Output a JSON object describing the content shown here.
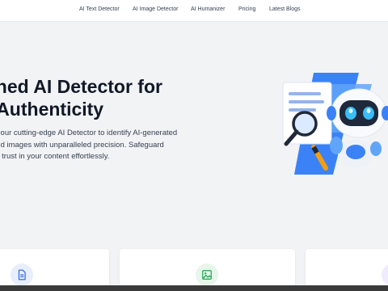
{
  "nav": {
    "items": [
      {
        "label": "AI Text Detector"
      },
      {
        "label": "AI Image Detector"
      },
      {
        "label": "AI Humanizer"
      },
      {
        "label": "Pricing"
      },
      {
        "label": "Latest Blogs"
      }
    ]
  },
  "hero": {
    "title_line1": "ched AI Detector for",
    "title_line2": "t Authenticity",
    "desc_line1": "of our cutting-edge AI Detector to identify AI-generated",
    "desc_line2": "and images with unparalleled precision. Safeguard",
    "desc_line3": "ild trust in your content effortlessly."
  },
  "cards": [
    {
      "icon": "document-icon",
      "color": "#2563eb",
      "bg": "#e8eefc"
    },
    {
      "icon": "image-icon",
      "color": "#16a34a",
      "bg": "#e6f6ea"
    },
    {
      "icon": "sparkle-icon",
      "color": "#7c3aed",
      "bg": "#f1ecfd"
    }
  ]
}
